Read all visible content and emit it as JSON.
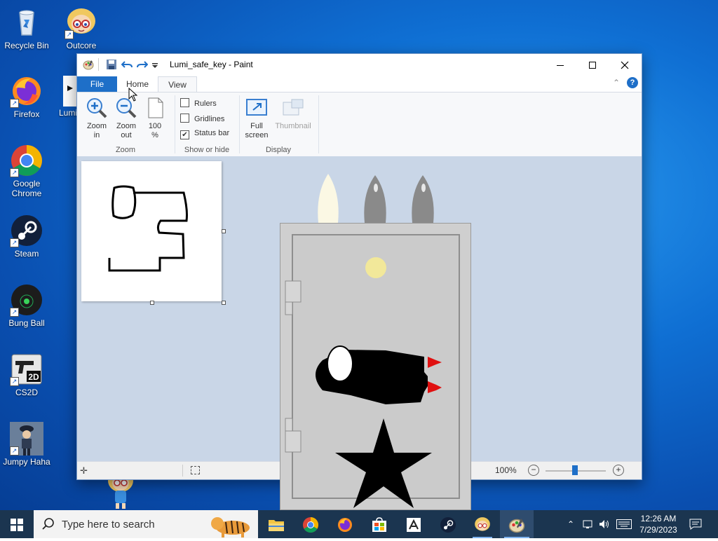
{
  "desktop": {
    "icons": [
      {
        "label": "Recycle Bin"
      },
      {
        "label": "Outcore"
      },
      {
        "label": "Firefox"
      },
      {
        "label": "Lumi"
      },
      {
        "label": "Google Chrome"
      },
      {
        "label": "Steam"
      },
      {
        "label": "Bung Ball"
      },
      {
        "label": "CS2D"
      },
      {
        "label": "Jumpy Haha"
      }
    ]
  },
  "paint": {
    "title": "Lumi_safe_key - Paint",
    "tabs": {
      "file": "File",
      "home": "Home",
      "view": "View"
    },
    "zoom_group": {
      "zoom_in_1": "Zoom",
      "zoom_in_2": "in",
      "zoom_out_1": "Zoom",
      "zoom_out_2": "out",
      "hundred_1": "100",
      "hundred_2": "%",
      "label": "Zoom"
    },
    "show_group": {
      "rulers": "Rulers",
      "gridlines": "Gridlines",
      "status_bar": "Status bar",
      "label": "Show or hide",
      "rulers_checked": false,
      "gridlines_checked": false,
      "status_checked": true
    },
    "display_group": {
      "full_1": "Full",
      "full_2": "screen",
      "thumbnail": "Thumbnail",
      "label": "Display"
    },
    "status": {
      "zoom": "100%"
    }
  },
  "taskbar": {
    "search_placeholder": "Type here to search",
    "time": "12:26 AM",
    "date": "7/29/2023"
  },
  "colors": {
    "accent": "#1e6fc8",
    "taskbar": "#1b3550",
    "canvas_bg": "#c9d6e7"
  }
}
